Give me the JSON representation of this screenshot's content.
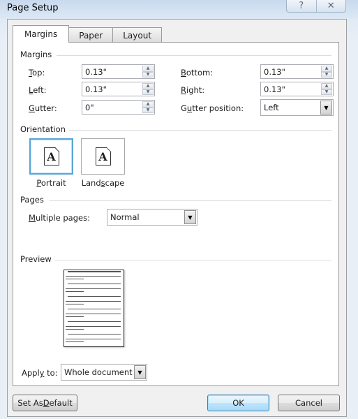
{
  "window": {
    "title": "Page Setup",
    "help_icon": "?",
    "close_icon": "✕"
  },
  "tabs": [
    {
      "label": "Margins",
      "active": true
    },
    {
      "label": "Paper",
      "active": false
    },
    {
      "label": "Layout",
      "active": false
    }
  ],
  "margins": {
    "section_label": "Margins",
    "top": {
      "label_u": "T",
      "label_rest": "op:",
      "value": "0.13\""
    },
    "left": {
      "label_u": "L",
      "label_rest": "eft:",
      "value": "0.13\""
    },
    "gutter": {
      "label_u": "G",
      "label_rest": "utter:",
      "value": "0\""
    },
    "bottom": {
      "label_u": "B",
      "label_rest": "ottom:",
      "value": "0.13\""
    },
    "right": {
      "label_u": "R",
      "label_rest": "ight:",
      "value": "0.13\""
    },
    "gutter_position": {
      "label_pre": "G",
      "label_u": "u",
      "label_rest": "tter position:",
      "value": "Left"
    },
    "spin_up": "▲",
    "spin_down": "▼",
    "dropdown_arrow": "▼"
  },
  "orientation": {
    "section_label": "Orientation",
    "portrait": {
      "label_u": "P",
      "label_rest": "ortrait",
      "glyph": "A",
      "selected": true
    },
    "landscape": {
      "label_pre": "Land",
      "label_u": "s",
      "label_rest": "cape",
      "glyph": "A",
      "selected": false
    }
  },
  "pages": {
    "section_label": "Pages",
    "multiple_pages": {
      "label_u": "M",
      "label_rest": "ultiple pages:",
      "value": "Normal"
    }
  },
  "preview": {
    "section_label": "Preview",
    "apply_to": {
      "label_pre": "Appl",
      "label_u": "y",
      "label_rest": " to:",
      "value": "Whole document"
    }
  },
  "buttons": {
    "set_default": {
      "label_pre": "Set As ",
      "label_u": "D",
      "label_rest": "efault"
    },
    "ok": "OK",
    "cancel": "Cancel"
  }
}
